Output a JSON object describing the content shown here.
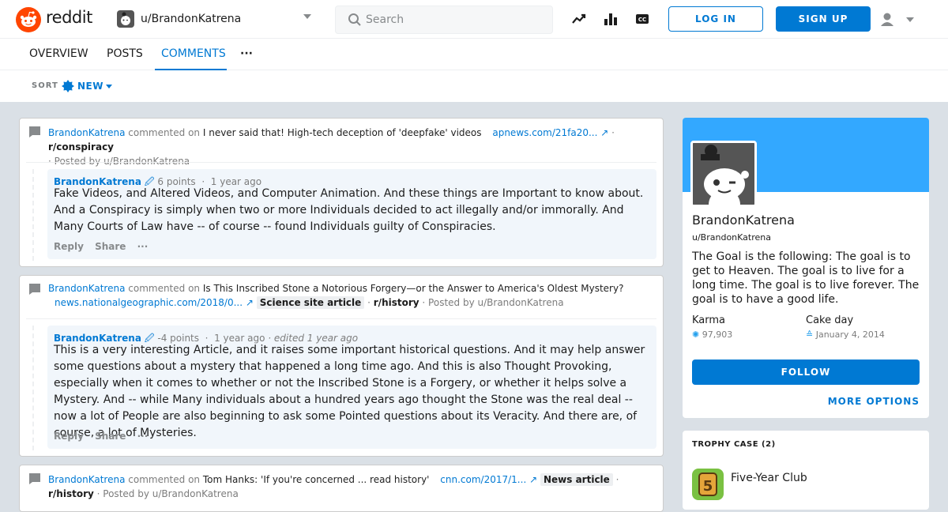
{
  "header": {
    "brand": "reddit",
    "user_switch": "u/BrandonKatrena",
    "search_placeholder": "Search",
    "login_label": "LOG IN",
    "signup_label": "SIGN UP"
  },
  "tabs": [
    "OVERVIEW",
    "POSTS",
    "COMMENTS",
    "···"
  ],
  "active_tab": "COMMENTS",
  "sort": {
    "label": "SORT",
    "value": "NEW"
  },
  "entries": [
    {
      "author": "BrandonKatrena",
      "commented_on": "commented on",
      "post_title": "I never said that! High-tech deception of 'deepfake' videos",
      "domain": "apnews.com/21fa20...",
      "flair": "",
      "subreddit": "r/conspiracy",
      "posted_by": "· Posted by u/BrandonKatrena",
      "comment": {
        "author": "BrandonKatrena",
        "points": "6 points",
        "time": "1 year ago",
        "edited": "",
        "text": "Fake Videos, and Altered Videos, and Computer Animation. And these things are Important to know about. And a Conspiracy is simply when two or more Individuals decided to act illegally and/or immorally. And Many Courts of Law have -- of course -- found Individuals guilty of Conspiracies.",
        "reply": "Reply",
        "share": "Share"
      }
    },
    {
      "author": "BrandonKatrena",
      "commented_on": "commented on",
      "post_title": "Is This Inscribed Stone a Notorious Forgery—or the Answer to America's Oldest Mystery?",
      "domain": "news.nationalgeographic.com/2018/0...",
      "flair": "Science site article",
      "subreddit": "r/history",
      "posted_by": "· Posted by u/BrandonKatrena",
      "comment": {
        "author": "BrandonKatrena",
        "points": "-4 points",
        "time": "1 year ago",
        "edited": "· edited 1 year ago",
        "text": "This is a very interesting Article, and it raises some important historical questions. And it may help answer some questions about a mystery that happened a long time ago. And this is also Thought Provoking, especially when it comes to whether or not the Inscribed Stone is a Forgery, or whether it helps solve a Mystery. And -- while Many individuals about a hundred years ago thought the Stone was the real deal -- now a lot of People are also beginning to ask some Pointed questions about its Veracity. And there are, of course, a lot of Mysteries.",
        "reply": "Reply",
        "share": "Share"
      }
    },
    {
      "author": "BrandonKatrena",
      "commented_on": "commented on",
      "post_title": "Tom Hanks: 'If you're concerned ... read history'",
      "domain": "cnn.com/2017/1...",
      "flair": "News article",
      "subreddit": "r/history",
      "posted_by": "· Posted by u/BrandonKatrena"
    }
  ],
  "profile": {
    "display_name": "BrandonKatrena",
    "username": "u/BrandonKatrena",
    "bio": "The Goal is the following: The goal is to get to Heaven. The goal is to live for a long time. The goal is to live forever. The goal is to have a good life.",
    "karma_label": "Karma",
    "karma_value": "97,903",
    "cakeday_label": "Cake day",
    "cakeday_value": "January 4, 2014",
    "follow_label": "FOLLOW",
    "more_options": "MORE OPTIONS"
  },
  "trophy_case": {
    "title": "TROPHY CASE (2)",
    "items": [
      {
        "name": "Five-Year Club",
        "icon": "five-year-club-icon"
      }
    ]
  },
  "colors": {
    "brand": "#ff4500",
    "accent": "#0079d3",
    "banner": "#33a8ff",
    "page_bg": "#dae0e6"
  }
}
